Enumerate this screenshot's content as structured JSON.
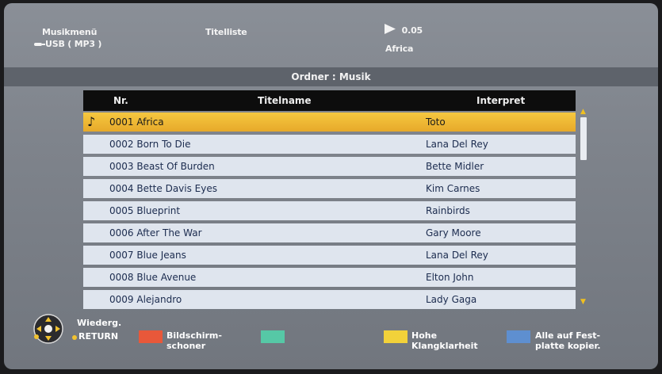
{
  "header": {
    "menu_title": "Musikmenü",
    "source": "USB ( MP3 )",
    "list_title": "Titelliste",
    "time": "0.05",
    "current_track": "Africa"
  },
  "folder_label": "Ordner : Musik",
  "table": {
    "columns": [
      "Nr.",
      "Titelname",
      "Interpret"
    ],
    "rows": [
      {
        "title": "0001 Africa",
        "artist": "Toto"
      },
      {
        "title": "0002 Born To Die",
        "artist": "Lana Del Rey"
      },
      {
        "title": "0003 Beast Of Burden",
        "artist": "Bette Midler"
      },
      {
        "title": "0004 Bette Davis Eyes",
        "artist": "Kim Carnes"
      },
      {
        "title": "0005 Blueprint",
        "artist": "Rainbirds"
      },
      {
        "title": "0006 After The War",
        "artist": "Gary Moore"
      },
      {
        "title": "0007 Blue Jeans",
        "artist": "Lana Del Rey"
      },
      {
        "title": "0008 Blue Avenue",
        "artist": "Elton John"
      },
      {
        "title": "0009 Alejandro",
        "artist": "Lady Gaga"
      }
    ],
    "selected_index": 0
  },
  "footer": {
    "play_label": "Wiederg.",
    "return_label": "RETURN",
    "red_label": [
      "Bildschirm-",
      "schoner"
    ],
    "green_label": "",
    "yellow_label": [
      "Hohe",
      "Klangklarheit"
    ],
    "blue_label": [
      "Alle auf Fest-",
      "platte kopier."
    ]
  },
  "colors": {
    "selection": "#f0b832",
    "red": "#e8583a",
    "green": "#56c8a6",
    "yellow": "#f2d23a",
    "blue": "#5e8fd0"
  }
}
